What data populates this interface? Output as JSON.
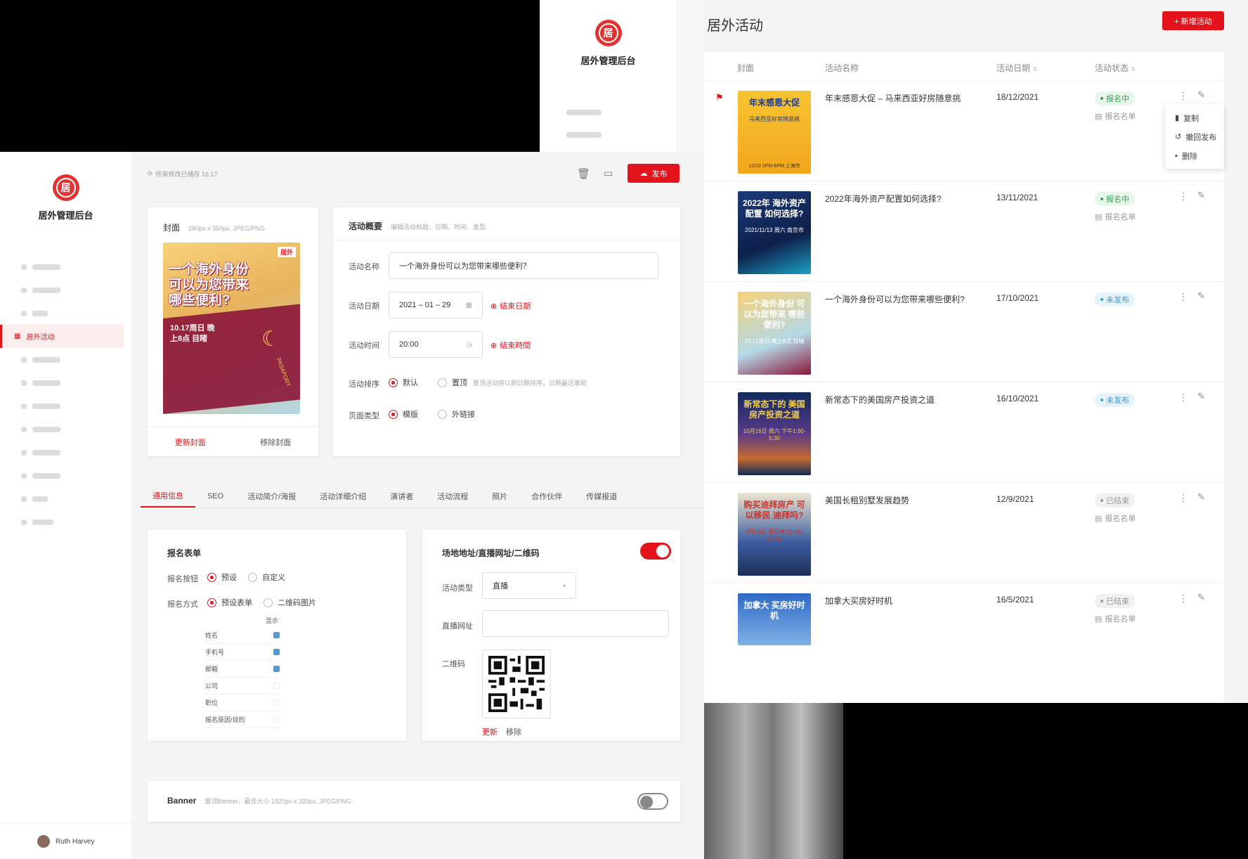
{
  "app_title": "居外管理后台",
  "logo_char": "居",
  "list_page": {
    "title": "居外活动",
    "add_button": "+ 新增活动",
    "columns": [
      "封面",
      "活动名称",
      "活动日期",
      "活动状态"
    ],
    "rows": [
      {
        "name": "年末感恩大促 – 马来西亚好房随意挑",
        "date": "18/12/2021",
        "status": "报名中",
        "status_style": "green",
        "signup": "报名名单",
        "flag": true,
        "poster_text": "年末感恩大促",
        "poster_sub": "马来西亚好房随意挑",
        "poster_footer": "12/18 2PM-6PM 上海市"
      },
      {
        "name": "2022年海外资产配置如何选择?",
        "date": "13/11/2021",
        "status": "报名中",
        "status_style": "green",
        "signup": "报名名单",
        "flag": false,
        "poster_text": "2022年 海外资产配置 如何选择?",
        "poster_sub": "2021/11/13 周六 南京市",
        "poster_footer": ""
      },
      {
        "name": "一个海外身份可以为您带来哪些便利?",
        "date": "17/10/2021",
        "status": "未发布",
        "status_style": "blue",
        "signup": "",
        "flag": false,
        "poster_text": "一个海外身份 可以为您带来 哪些便利?",
        "poster_sub": "10.17周日 晚上8点 目睹",
        "poster_footer": ""
      },
      {
        "name": "新常态下的美国房产投资之道",
        "date": "16/10/2021",
        "status": "未发布",
        "status_style": "blue",
        "signup": "",
        "flag": false,
        "poster_text": "新常态下的 美国房产投资之道",
        "poster_sub": "10月16日 周六 下午1:30-5:30",
        "poster_footer": ""
      },
      {
        "name": "美国长租别墅发展趋势",
        "date": "12/9/2021",
        "status": "已结束",
        "status_style": "gray",
        "signup": "报名名单",
        "flag": false,
        "poster_text": "购买迪拜房产 可以移民 迪拜吗?",
        "poster_sub": "9月29日 周日晚 20:00-20:45",
        "poster_footer": ""
      },
      {
        "name": "加拿大买房好时机",
        "date": "16/5/2021",
        "status": "已结束",
        "status_style": "gray",
        "signup": "报名名单",
        "flag": false,
        "poster_text": "加拿大 买房好时机",
        "poster_sub": "",
        "poster_footer": ""
      }
    ],
    "context_menu": [
      "复制",
      "撤回发布",
      "删除"
    ]
  },
  "editor": {
    "autosave_text": "所有修改已储存 16:17",
    "publish_button": "发布",
    "cover": {
      "title": "封面",
      "hint": "280px x 350px, JPEG/PNG",
      "poster_lines": [
        "一个海外身份",
        "可以为您带来",
        "哪些便利?"
      ],
      "poster_date": "10.17周日 晚上8点 目睹",
      "poster_brand": "居外",
      "passport_text": "PASAPORT",
      "update_link": "更新封面",
      "remove_link": "移除封面"
    },
    "overview": {
      "title": "活动概要",
      "hint": "编辑活动标题、日期、时间、类型",
      "name_label": "活动名称",
      "name_value": "一个海外身份可以为您带来哪些便利？",
      "date_label": "活动日期",
      "date_value": "2021 – 01 – 29",
      "end_date": "结束日期",
      "time_label": "活动时间",
      "time_value": "20:00",
      "end_time": "结束時間",
      "sort_label": "活动排序",
      "sort_default": "默认",
      "sort_top": "置顶",
      "sort_hint": "置顶活动将以期日期排序，日期最近靠前",
      "page_type_label": "页面类型",
      "page_type_template": "模版",
      "page_type_link": "外链接"
    },
    "tabs": [
      "通用信息",
      "SEO",
      "活动简介/海报",
      "活动详细介绍",
      "演讲者",
      "活动流程",
      "照片",
      "合作伙伴",
      "传媒报道"
    ],
    "signup_form": {
      "title": "报名表单",
      "button_label": "报名按钮",
      "button_preset": "预设",
      "button_custom": "自定义",
      "method_label": "报名方式",
      "method_preset": "预设表单",
      "method_qr": "二维码图片",
      "display_header": "显示",
      "fields": [
        {
          "name": "姓名",
          "checked": true
        },
        {
          "name": "手机号",
          "checked": true
        },
        {
          "name": "邮箱",
          "checked": true
        },
        {
          "name": "公司",
          "checked": false
        },
        {
          "name": "职位",
          "checked": false
        },
        {
          "name": "报名原因/目的",
          "checked": false
        }
      ]
    },
    "venue": {
      "title": "场地地址/直播网址/二维码",
      "toggle_on": true,
      "type_label": "活动类型",
      "type_value": "直播",
      "url_label": "直播网址",
      "url_value": "",
      "qr_label": "二维码",
      "qr_update": "更新",
      "qr_remove": "移除"
    },
    "banner": {
      "title": "Banner",
      "hint": "置顶Banner，最佳大小 1920px x 320px, JPEG/PNG",
      "toggle_on": false
    }
  },
  "user": {
    "name": "Ruth Harvey"
  },
  "colors": {
    "brand_red": "#e2131b",
    "green": "#35a14f",
    "blue": "#3a99cf"
  }
}
